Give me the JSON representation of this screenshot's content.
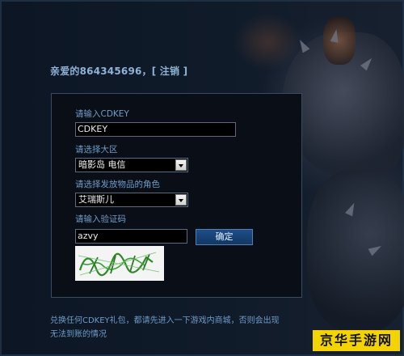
{
  "header": {
    "greeting": "亲爱的864345696，",
    "logout_label": "[ 注销 ]"
  },
  "form": {
    "cdkey_label": "请输入CDKEY",
    "cdkey_value": "CDKEY",
    "region_label": "请选择大区",
    "region_selected": "暗影岛 电信",
    "role_label": "请选择发放物品的角色",
    "role_selected": "艾瑞斯儿",
    "captcha_label": "请输入验证码",
    "captcha_value": "azvy",
    "captcha_image_text": "azvy",
    "confirm_label": "确定"
  },
  "notice": "兑换任何CDKEY礼包，都请先进入一下游戏内商城，否则会出现无法到账的情况",
  "watermark": "京华手游网",
  "colors": {
    "label_blue": "#6f9cc8",
    "greeting_blue": "#8fb3d6",
    "button_blue": "#1d4e86",
    "watermark_yellow": "#f4d400"
  }
}
